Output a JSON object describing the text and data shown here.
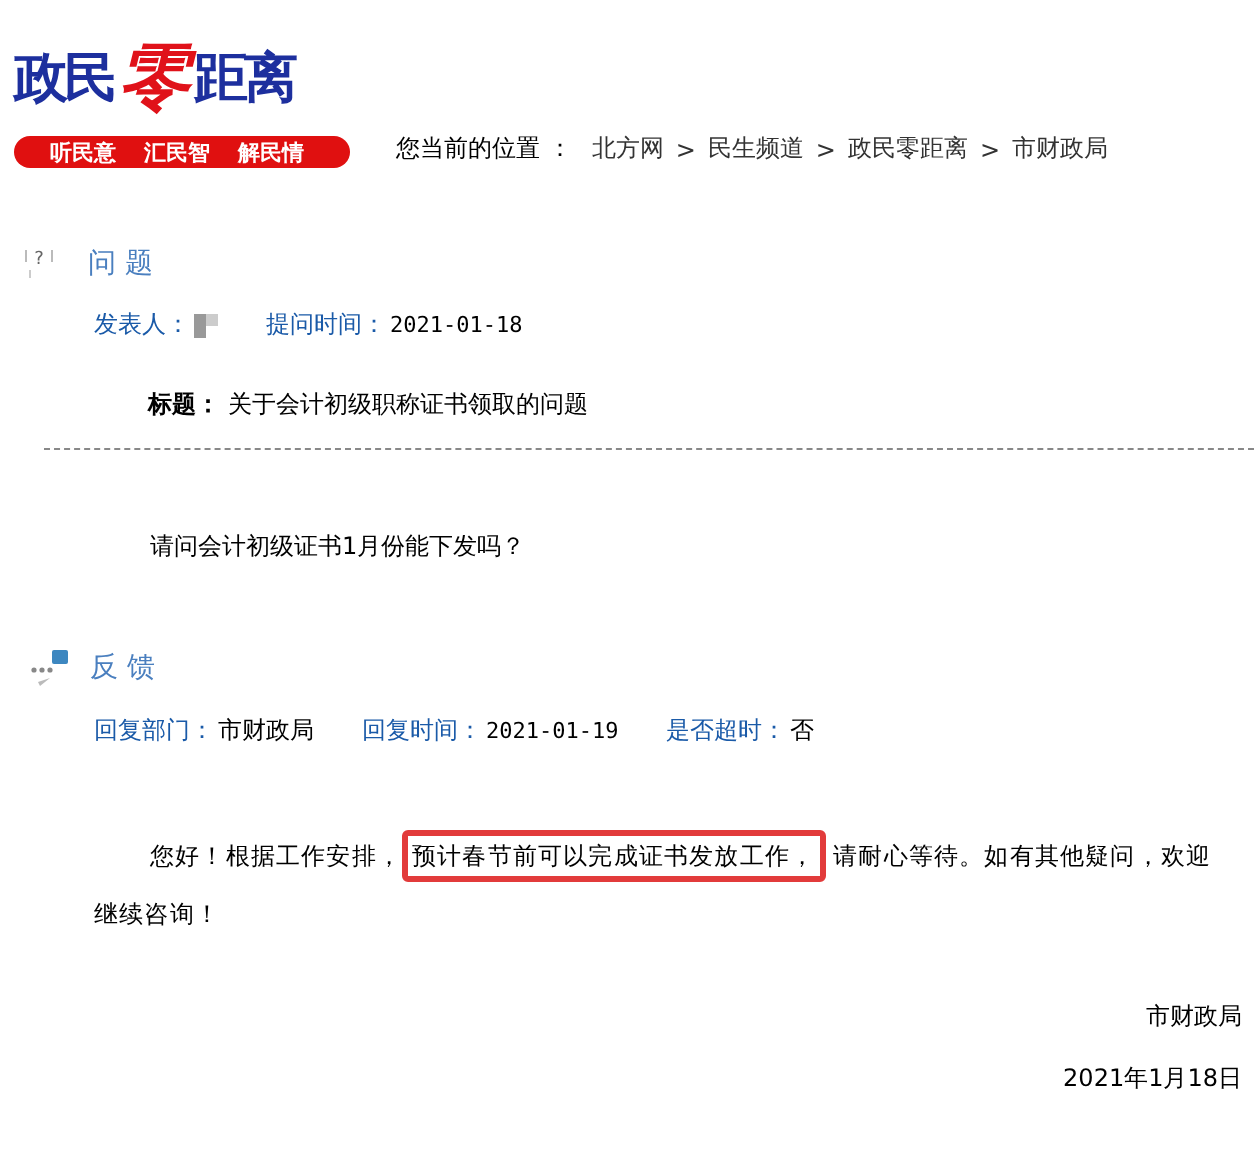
{
  "logo": {
    "parts": [
      "政民",
      "零",
      "距离"
    ],
    "slogans": [
      "听民意",
      "汇民智",
      "解民情"
    ]
  },
  "breadcrumb": {
    "label": "您当前的位置 ：",
    "items": [
      "北方网",
      "民生频道",
      "政民零距离",
      "市财政局"
    ],
    "separator": ">"
  },
  "question": {
    "icon": "?",
    "heading": "问 题",
    "poster_label": "发表人：",
    "time_label": "提问时间：",
    "time": "2021-01-18",
    "title_label": "标题：",
    "title": "关于会计初级职称证书领取的问题",
    "body": "请问会计初级证书1月份能下发吗？"
  },
  "feedback": {
    "heading": "反 馈",
    "dept_label": "回复部门：",
    "dept": "市财政局",
    "time_label": "回复时间：",
    "time": "2021-01-19",
    "overdue_label": "是否超时：",
    "overdue": "否",
    "body_before": "您好！根据工作安排，",
    "body_highlight": "预计春节前可以完成证书发放工作，",
    "body_after": "请耐心等待。如有其他疑问，欢迎继续咨询！",
    "highlighted": true,
    "signature": "市财政局",
    "date": "2021年1月18日"
  }
}
